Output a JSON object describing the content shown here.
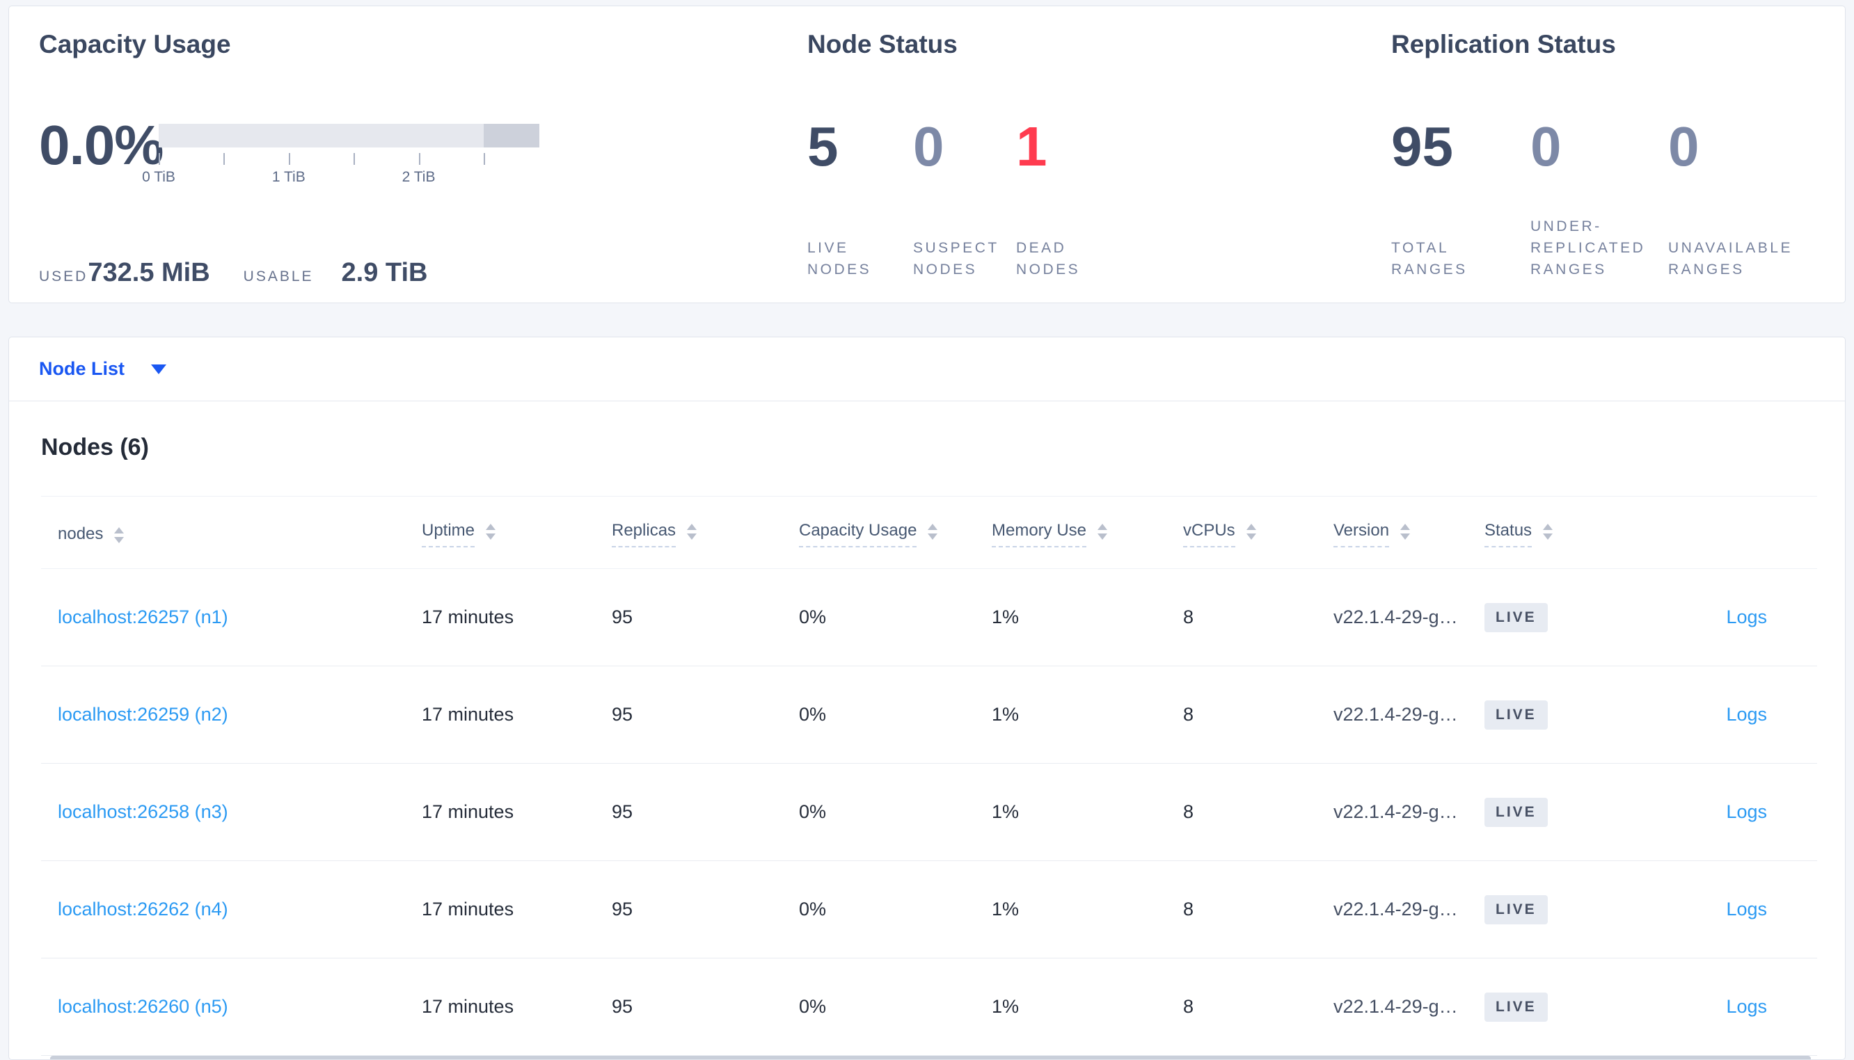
{
  "summary": {
    "capacity": {
      "title": "Capacity Usage",
      "percent": "0.0%",
      "bar": {
        "dark_segment_start_pct": 85.4,
        "tick_positions_pct": [
          0,
          17.07,
          34.15,
          51.22,
          68.29,
          85.37
        ]
      },
      "axis_labels": [
        "0 TiB",
        "1 TiB",
        "2 TiB"
      ],
      "used_label": "USED",
      "used_value": "732.5 MiB",
      "usable_label": "USABLE",
      "usable_value": "2.9 TiB"
    },
    "node_status": {
      "title": "Node Status",
      "stats": [
        {
          "value": "5",
          "label": "LIVE NODES"
        },
        {
          "value": "0",
          "label": "SUSPECT NODES"
        },
        {
          "value": "1",
          "label": "DEAD NODES"
        }
      ]
    },
    "replication": {
      "title": "Replication Status",
      "stats": [
        {
          "value": "95",
          "label": "TOTAL RANGES"
        },
        {
          "value": "0",
          "label": "UNDER-REPLICATED RANGES"
        },
        {
          "value": "0",
          "label": "UNAVAILABLE RANGES"
        }
      ]
    }
  },
  "node_list": {
    "dropdown_label": "Node List",
    "heading": "Nodes (6)",
    "logs_label": "Logs",
    "columns": [
      {
        "label": "nodes",
        "sortable": true,
        "tooltip": false
      },
      {
        "label": "Uptime",
        "sortable": true,
        "tooltip": true
      },
      {
        "label": "Replicas",
        "sortable": true,
        "tooltip": true
      },
      {
        "label": "Capacity Usage",
        "sortable": true,
        "tooltip": true
      },
      {
        "label": "Memory Use",
        "sortable": true,
        "tooltip": true
      },
      {
        "label": "vCPUs",
        "sortable": true,
        "tooltip": true
      },
      {
        "label": "Version",
        "sortable": true,
        "tooltip": true
      },
      {
        "label": "Status",
        "sortable": true,
        "tooltip": true
      }
    ],
    "rows": [
      {
        "address": "localhost:26257 (n1)",
        "uptime": "17 minutes",
        "replicas": "95",
        "capacity": "0%",
        "memory": "1%",
        "vcpus": "8",
        "version": "v22.1.4-29-g…",
        "status": "LIVE"
      },
      {
        "address": "localhost:26259 (n2)",
        "uptime": "17 minutes",
        "replicas": "95",
        "capacity": "0%",
        "memory": "1%",
        "vcpus": "8",
        "version": "v22.1.4-29-g…",
        "status": "LIVE"
      },
      {
        "address": "localhost:26258 (n3)",
        "uptime": "17 minutes",
        "replicas": "95",
        "capacity": "0%",
        "memory": "1%",
        "vcpus": "8",
        "version": "v22.1.4-29-g…",
        "status": "LIVE"
      },
      {
        "address": "localhost:26262 (n4)",
        "uptime": "17 minutes",
        "replicas": "95",
        "capacity": "0%",
        "memory": "1%",
        "vcpus": "8",
        "version": "v22.1.4-29-g…",
        "status": "LIVE"
      },
      {
        "address": "localhost:26260 (n5)",
        "uptime": "17 minutes",
        "replicas": "95",
        "capacity": "0%",
        "memory": "1%",
        "vcpus": "8",
        "version": "v22.1.4-29-g…",
        "status": "LIVE"
      }
    ]
  },
  "icons": {
    "dropdown_caret": "caret-down",
    "sort": "sort-arrows"
  },
  "colors": {
    "page_bg": "#f4f6fa",
    "accent_blue": "#1a57f2",
    "link_blue": "#2b9af3",
    "stat_dark": "#3f4c66",
    "stat_muted": "#7d89a7",
    "stat_danger": "#ff3b4f",
    "badge_bg": "#e7ebf2"
  }
}
